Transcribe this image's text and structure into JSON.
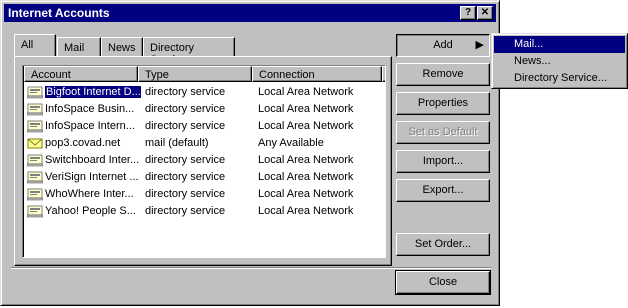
{
  "window": {
    "title": "Internet Accounts",
    "help_btn": "?",
    "close_btn": "✕"
  },
  "tabs": [
    {
      "label": "All"
    },
    {
      "label": "Mail"
    },
    {
      "label": "News"
    },
    {
      "label": "Directory Service"
    }
  ],
  "list": {
    "columns": [
      "Account",
      "Type",
      "Connection"
    ],
    "rows": [
      {
        "account": "Bigfoot Internet D...",
        "type": "directory service",
        "connection": "Local Area Network",
        "icon": "directory-service-icon"
      },
      {
        "account": "InfoSpace Busin...",
        "type": "directory service",
        "connection": "Local Area Network",
        "icon": "directory-service-icon"
      },
      {
        "account": "InfoSpace Intern...",
        "type": "directory service",
        "connection": "Local Area Network",
        "icon": "directory-service-icon"
      },
      {
        "account": "pop3.covad.net",
        "type": "mail (default)",
        "connection": "Any Available",
        "icon": "mail-account-icon"
      },
      {
        "account": "Switchboard Inter...",
        "type": "directory service",
        "connection": "Local Area Network",
        "icon": "directory-service-icon"
      },
      {
        "account": "VeriSign Internet ...",
        "type": "directory service",
        "connection": "Local Area Network",
        "icon": "directory-service-icon"
      },
      {
        "account": "WhoWhere Inter...",
        "type": "directory service",
        "connection": "Local Area Network",
        "icon": "directory-service-icon"
      },
      {
        "account": "Yahoo! People S...",
        "type": "directory service",
        "connection": "Local Area Network",
        "icon": "directory-service-icon"
      }
    ]
  },
  "buttons": {
    "add": "Add",
    "remove": "Remove",
    "properties": "Properties",
    "set_default": "Set as Default",
    "import": "Import...",
    "export": "Export...",
    "set_order": "Set Order...",
    "close": "Close"
  },
  "add_menu": [
    {
      "label": "Mail..."
    },
    {
      "label": "News..."
    },
    {
      "label": "Directory Service..."
    }
  ],
  "colors": {
    "titlebar": "#000080",
    "face": "#c0c0c0",
    "highlight": "#000080"
  }
}
